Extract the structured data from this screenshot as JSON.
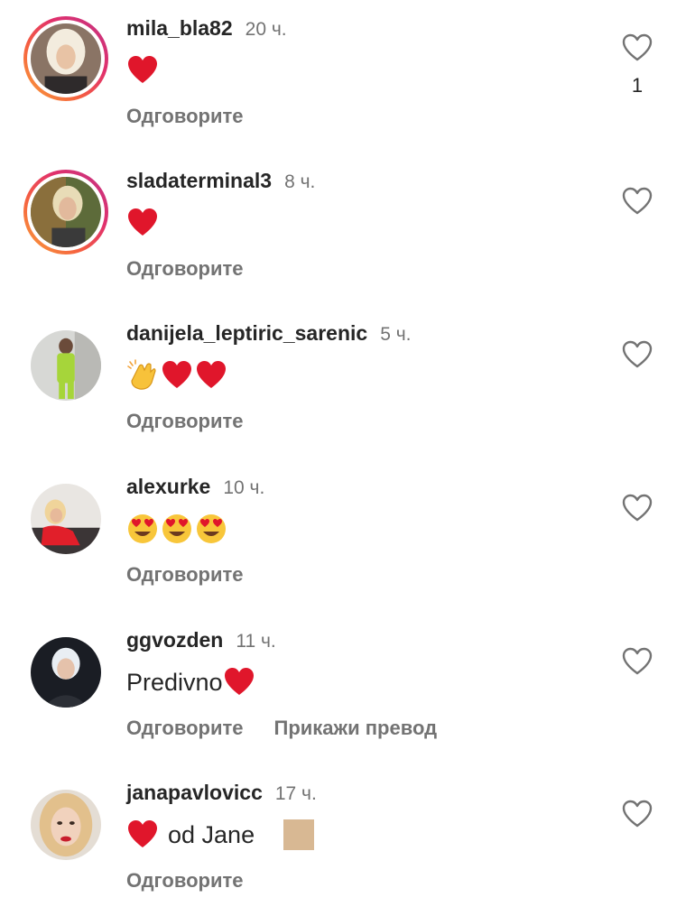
{
  "comments": [
    {
      "username": "mila_bla82",
      "time": "20 ч.",
      "text": "",
      "emojis": [
        "red-heart"
      ],
      "reply_label": "Одговорите",
      "like_count": "1",
      "has_story_ring": true
    },
    {
      "username": "sladaterminal3",
      "time": "8 ч.",
      "text": "",
      "emojis": [
        "red-heart"
      ],
      "reply_label": "Одговорите",
      "like_count": "",
      "has_story_ring": true
    },
    {
      "username": "danijela_leptiric_sarenic",
      "time": "5 ч.",
      "text": "",
      "emojis": [
        "clapping-hands",
        "red-heart",
        "red-heart"
      ],
      "reply_label": "Одговорите",
      "like_count": "",
      "has_story_ring": false
    },
    {
      "username": "alexurke",
      "time": "10 ч.",
      "text": "",
      "emojis": [
        "heart-eyes",
        "heart-eyes",
        "heart-eyes"
      ],
      "reply_label": "Одговорите",
      "like_count": "",
      "has_story_ring": false
    },
    {
      "username": "ggvozden",
      "time": "11 ч.",
      "text": "Predivno",
      "emojis": [
        "red-heart"
      ],
      "reply_label": "Одговорите",
      "translate_label": "Прикажи превод",
      "like_count": "",
      "has_story_ring": false
    },
    {
      "username": "janapavlovicc",
      "time": "17 ч.",
      "text": "od Jane",
      "emojis": [
        "red-heart"
      ],
      "reply_label": "Одговорите",
      "like_count": "",
      "has_story_ring": false
    }
  ],
  "colors": {
    "text": "#262626",
    "secondary": "#737373",
    "heart_red": "#e0162b",
    "story_ring_start": "#f9a33a",
    "story_ring_end": "#c13584"
  },
  "icons": {
    "like": "heart-outline-icon",
    "heart": "red-heart-emoji",
    "clap": "clapping-hands-emoji",
    "heart_eyes": "heart-eyes-emoji"
  }
}
